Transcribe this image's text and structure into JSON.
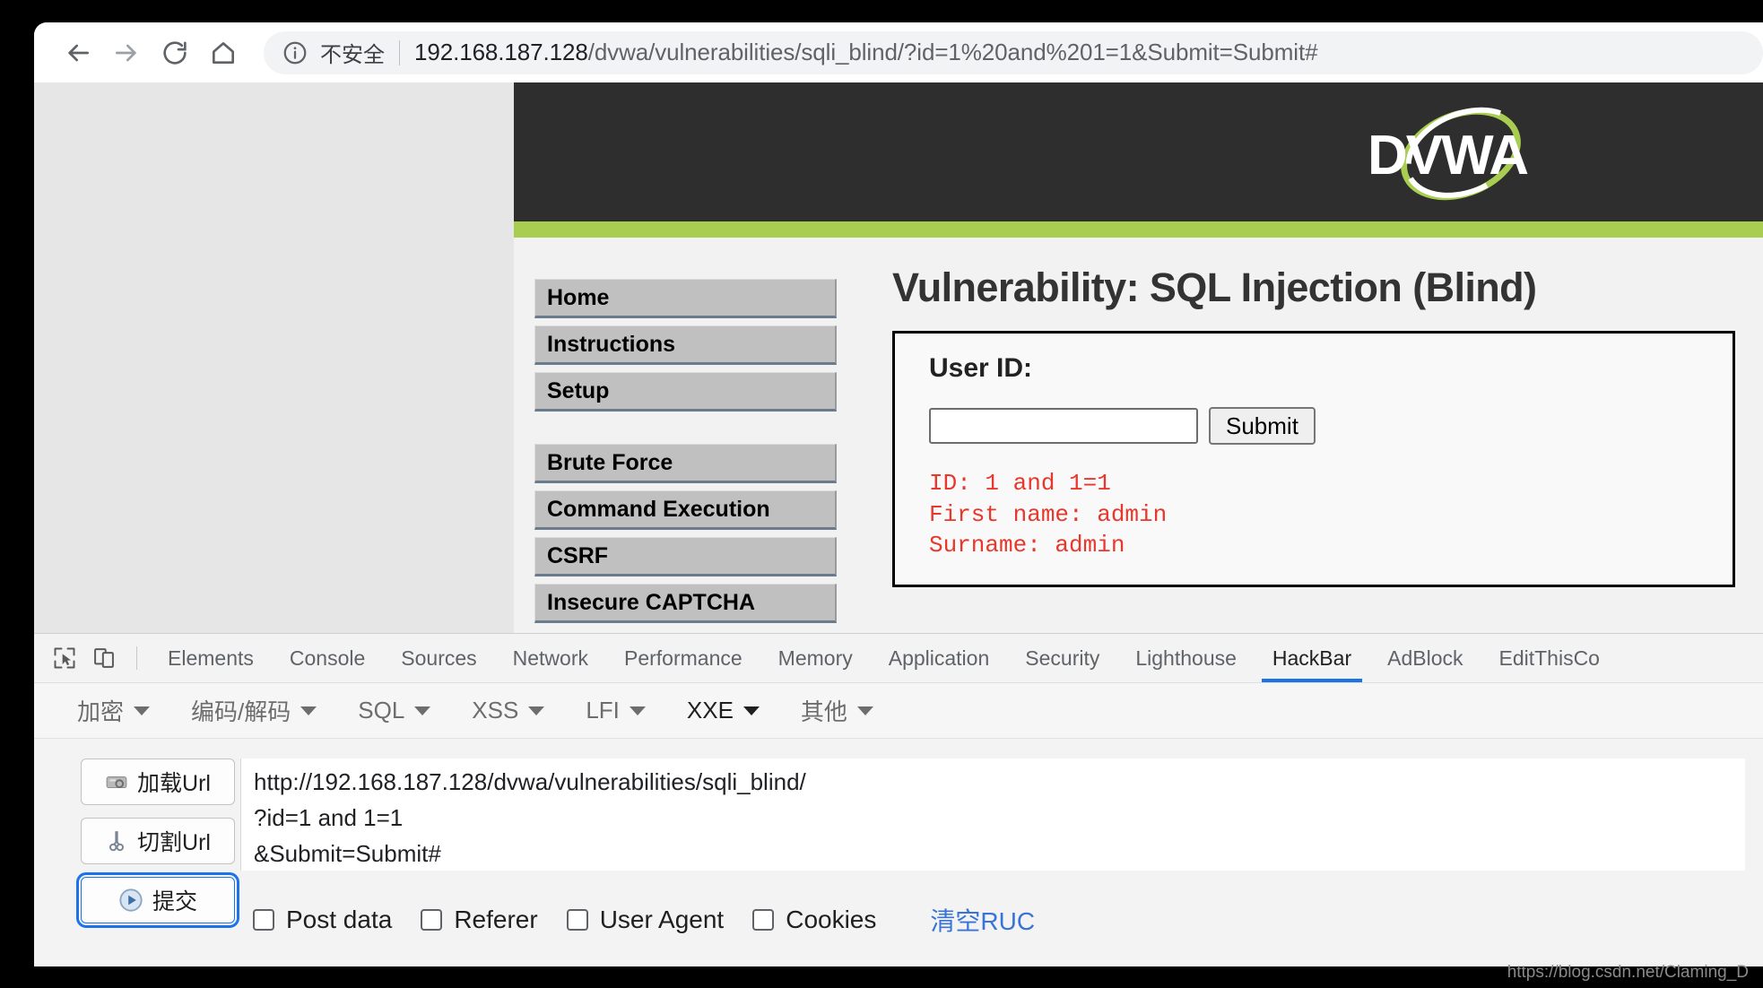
{
  "browser": {
    "nav": {
      "back": "back-arrow",
      "forward": "forward-arrow",
      "reload": "reload",
      "home": "home"
    },
    "security_label": "不安全",
    "url_host": "192.168.187.128",
    "url_path": "/dvwa/vulnerabilities/sqli_blind/?id=1%20and%201=1&Submit=Submit#"
  },
  "page": {
    "logo_text": "DVWA",
    "accent_green": "#a8cd51",
    "header_bg": "#2e2e2e",
    "sidebar": {
      "group1": [
        "Home",
        "Instructions",
        "Setup"
      ],
      "group2": [
        "Brute Force",
        "Command Execution",
        "CSRF",
        "Insecure CAPTCHA"
      ]
    },
    "title": "Vulnerability: SQL Injection (Blind)",
    "form": {
      "label": "User ID:",
      "input_value": "",
      "input_placeholder": "",
      "submit_label": "Submit"
    },
    "result": {
      "color": "#e8372c",
      "lines": [
        "ID: 1 and 1=1",
        "First name: admin",
        "Surname: admin"
      ]
    }
  },
  "devtools": {
    "tabs": [
      {
        "label": "Elements",
        "active": false
      },
      {
        "label": "Console",
        "active": false
      },
      {
        "label": "Sources",
        "active": false
      },
      {
        "label": "Network",
        "active": false
      },
      {
        "label": "Performance",
        "active": false
      },
      {
        "label": "Memory",
        "active": false
      },
      {
        "label": "Application",
        "active": false
      },
      {
        "label": "Security",
        "active": false
      },
      {
        "label": "Lighthouse",
        "active": false
      },
      {
        "label": "HackBar",
        "active": true
      },
      {
        "label": "AdBlock",
        "active": false
      },
      {
        "label": "EditThisCo",
        "active": false
      }
    ],
    "active_tab_accent": "#1a73e8"
  },
  "hackbar": {
    "menus": [
      {
        "label": "加密",
        "strong": false
      },
      {
        "label": "编码/解码",
        "strong": false
      },
      {
        "label": "SQL",
        "strong": false
      },
      {
        "label": "XSS",
        "strong": false
      },
      {
        "label": "LFI",
        "strong": false
      },
      {
        "label": "XXE",
        "strong": true
      },
      {
        "label": "其他",
        "strong": false
      }
    ],
    "buttons": [
      {
        "label": "加载Url",
        "icon": "load-url-icon",
        "focused": false
      },
      {
        "label": "切割Url",
        "icon": "scissors-icon",
        "focused": false
      },
      {
        "label": "提交",
        "icon": "play-icon",
        "focused": true
      }
    ],
    "request_value": "http://192.168.187.128/dvwa/vulnerabilities/sqli_blind/\n?id=1 and 1=1\n&Submit=Submit#",
    "request_placeholder": "",
    "checkboxes": [
      {
        "label": "Post data",
        "checked": false
      },
      {
        "label": "Referer",
        "checked": false
      },
      {
        "label": "User Agent",
        "checked": false
      },
      {
        "label": "Cookies",
        "checked": false
      }
    ],
    "clear_link": "清空RUC"
  },
  "watermark": "https://blog.csdn.net/Claming_D"
}
